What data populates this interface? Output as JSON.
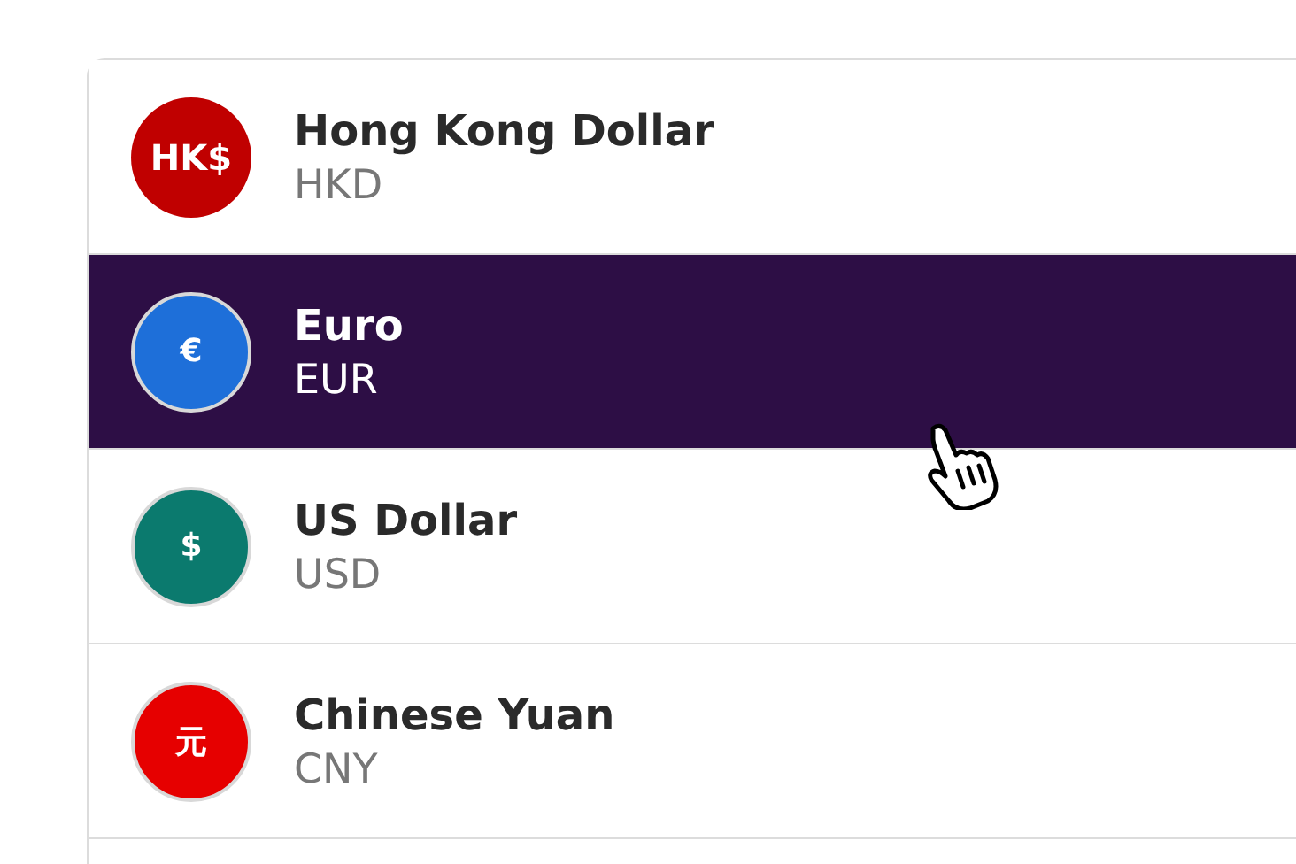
{
  "currencies": [
    {
      "name": "Hong Kong Dollar",
      "code": "HKD",
      "symbol": "HK$",
      "color": "#c00000",
      "selected": false
    },
    {
      "name": "Euro",
      "code": "EUR",
      "symbol": "€",
      "color": "#1e6fd9",
      "selected": true
    },
    {
      "name": "US Dollar",
      "code": "USD",
      "symbol": "$",
      "color": "#0b7a6e",
      "selected": false
    },
    {
      "name": "Chinese Yuan",
      "code": "CNY",
      "symbol": "元",
      "color": "#e60000",
      "selected": false
    }
  ]
}
